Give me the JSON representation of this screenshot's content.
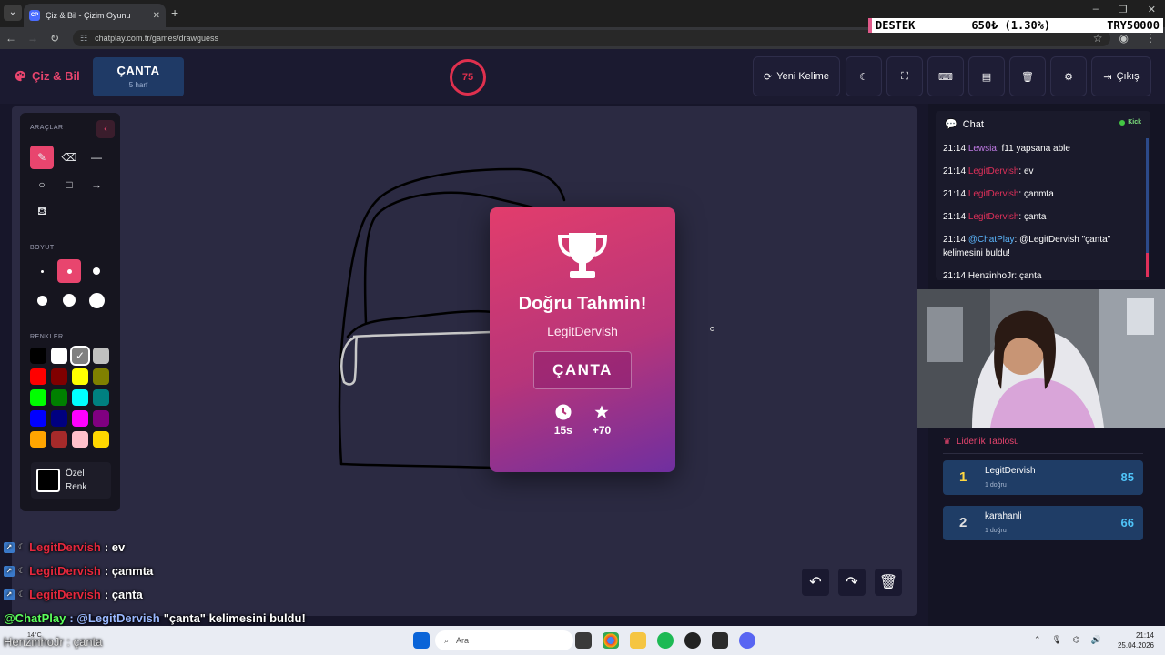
{
  "browser": {
    "tab_title": "Çiz & Bil - Çizim Oyunu",
    "favicon_text": "CP",
    "url": "chatplay.com.tr/games/drawguess"
  },
  "ticker": {
    "label": "DESTEK",
    "value": "650₺ (1.30%)",
    "goal": "TRY50000"
  },
  "header": {
    "brand": "Çiz & Bil",
    "word": "ÇANTA",
    "word_hint": "5 harf",
    "timer": "75",
    "new_word": "Yeni Kelime",
    "exit": "Çıkış"
  },
  "tools": {
    "tools_label": "ARAÇLAR",
    "size_label": "BOYUT",
    "colors_label": "RENKLER",
    "custom_color": "Özel",
    "custom_color_2": "Renk",
    "colors": [
      "#000000",
      "#ffffff",
      "#808080",
      "#c0c0c0",
      "#ff0000",
      "#800000",
      "#ffff00",
      "#808000",
      "#00ff00",
      "#008000",
      "#00ffff",
      "#008080",
      "#0000ff",
      "#000080",
      "#ff00ff",
      "#800080",
      "#ffa500",
      "#a52a2a",
      "#ffc0cb",
      "#ffd700"
    ]
  },
  "result": {
    "title": "Doğru Tahmin!",
    "player": "LegitDervish",
    "word": "ÇANTA",
    "time": "15s",
    "points": "+70"
  },
  "chat": {
    "title": "Chat",
    "platform": "Kick",
    "messages": [
      {
        "time": "21:14",
        "user": "Lewsia",
        "text": ": f11 yapsana able",
        "color": "#c17be6"
      },
      {
        "time": "21:14",
        "user": "LegitDervish",
        "text": ": ev",
        "color": "#e0305a"
      },
      {
        "time": "21:14",
        "user": "LegitDervish",
        "text": ": çanmta",
        "color": "#e0305a"
      },
      {
        "time": "21:14",
        "user": "LegitDervish",
        "text": ": çanta",
        "color": "#e0305a"
      },
      {
        "time": "21:14",
        "user": "@ChatPlay",
        "text": ": @LegitDervish \"çanta\" kelimesini buldu!",
        "color": "#5cb8ff"
      },
      {
        "time": "21:14",
        "user": "HenzinhoJr",
        "text": ": çanta",
        "color": "#ffffff"
      }
    ]
  },
  "leaderboard": {
    "title": "Liderlik Tablosu",
    "rows": [
      {
        "rank": "1",
        "name": "LegitDervish",
        "sub": "1 doğru",
        "score": "85",
        "rank_color": "#ffd740"
      },
      {
        "rank": "2",
        "name": "karahanli",
        "sub": "1 doğru",
        "score": "66",
        "rank_color": "#e0e0e0"
      }
    ]
  },
  "overlay": [
    {
      "user": "LegitDervish",
      "text": ": ev"
    },
    {
      "user": "LegitDervish",
      "text": ": çanmta"
    },
    {
      "user": "LegitDervish",
      "text": ": çanta"
    }
  ],
  "overlay_announce": {
    "user": "@ChatPlay",
    "mention": ": @LegitDervish",
    "text": " \"çanta\" kelimesini buldu!"
  },
  "overlay_last": "HenzinhoJr : çanta",
  "taskbar": {
    "weather": "14°C",
    "search": "Ara",
    "time": "21:14",
    "date": "25.04.2026"
  }
}
